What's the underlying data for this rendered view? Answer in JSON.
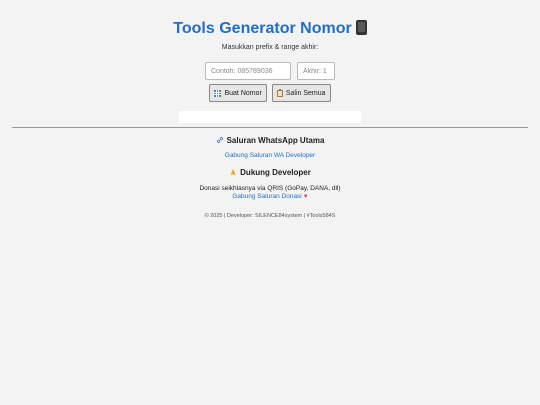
{
  "header": {
    "title": "Tools Generator Nomor",
    "title_icon": "mobile-phone-icon",
    "subtitle": "Masukkan prefix & range akhir:"
  },
  "form": {
    "prefix_placeholder": "Contoh: 085789036",
    "akhir_placeholder": "Akhir: 1",
    "generate_label": "Buat Nomor",
    "generate_icon": "grid-icon",
    "copy_label": "Salin Semua",
    "copy_icon": "clipboard-icon"
  },
  "channel": {
    "heading": "Saluran WhatsApp Utama",
    "heading_icon": "link-icon",
    "link_text": "Gabung Saluran WA Developer"
  },
  "donate": {
    "heading": "Dukung Developer",
    "heading_icon": "praying-hands-icon",
    "text": "Donasi seikhlasnya via QRIS (GoPay, DANA, dll)",
    "link_text": "Gabung Saluran Donasi",
    "link_icon": "heart-icon"
  },
  "footer": {
    "text": "© 2025 | Developer: SILENCE84system | #Tools584S"
  },
  "colors": {
    "accent": "#1f6fc7",
    "background": "#f3f3f3"
  }
}
